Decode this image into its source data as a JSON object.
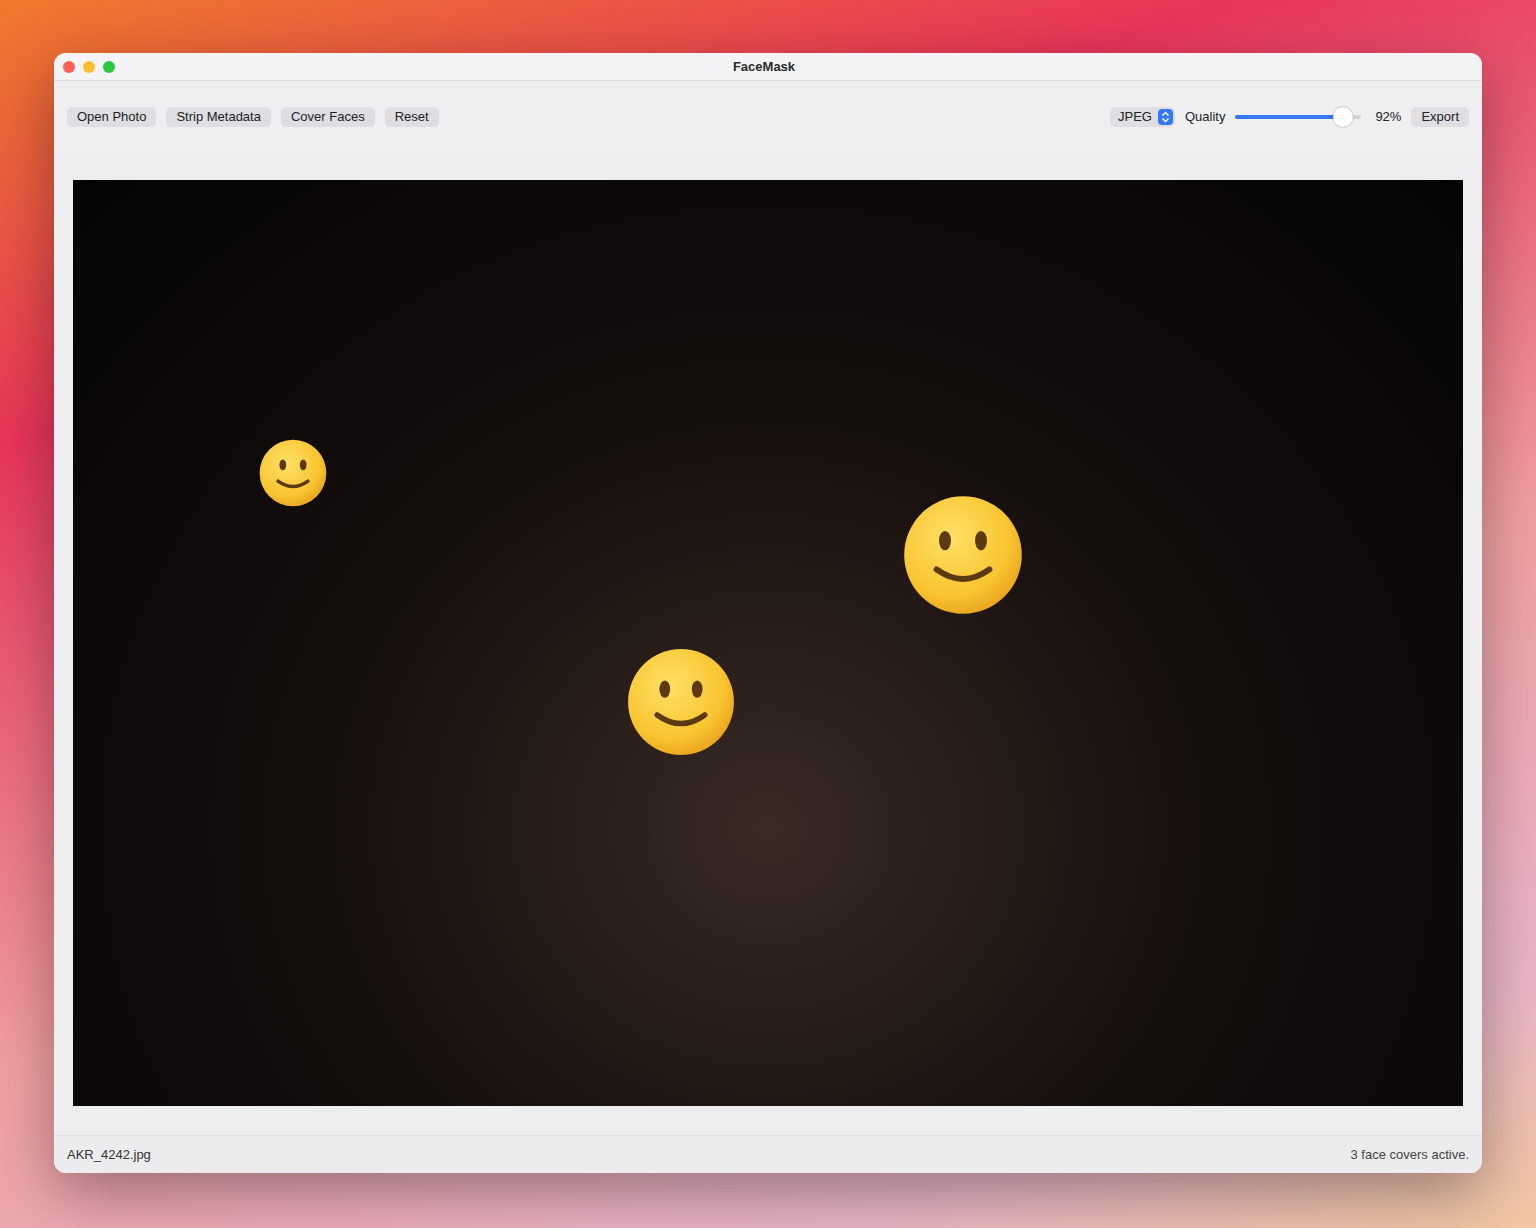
{
  "window": {
    "title": "FaceMask"
  },
  "toolbar": {
    "buttons": [
      "Open Photo",
      "Strip Metadata",
      "Cover Faces",
      "Reset"
    ],
    "format": {
      "value": "JPEG"
    },
    "quality": {
      "label": "Quality",
      "level": 0.85,
      "reading": "92%"
    },
    "export": "Export"
  },
  "photo": {
    "face_covers": [
      {
        "active": true
      },
      {
        "active": true
      },
      {
        "active": true
      }
    ]
  },
  "status_bar": {
    "file": "AKR_4242.jpg",
    "message": "3 face covers active."
  }
}
